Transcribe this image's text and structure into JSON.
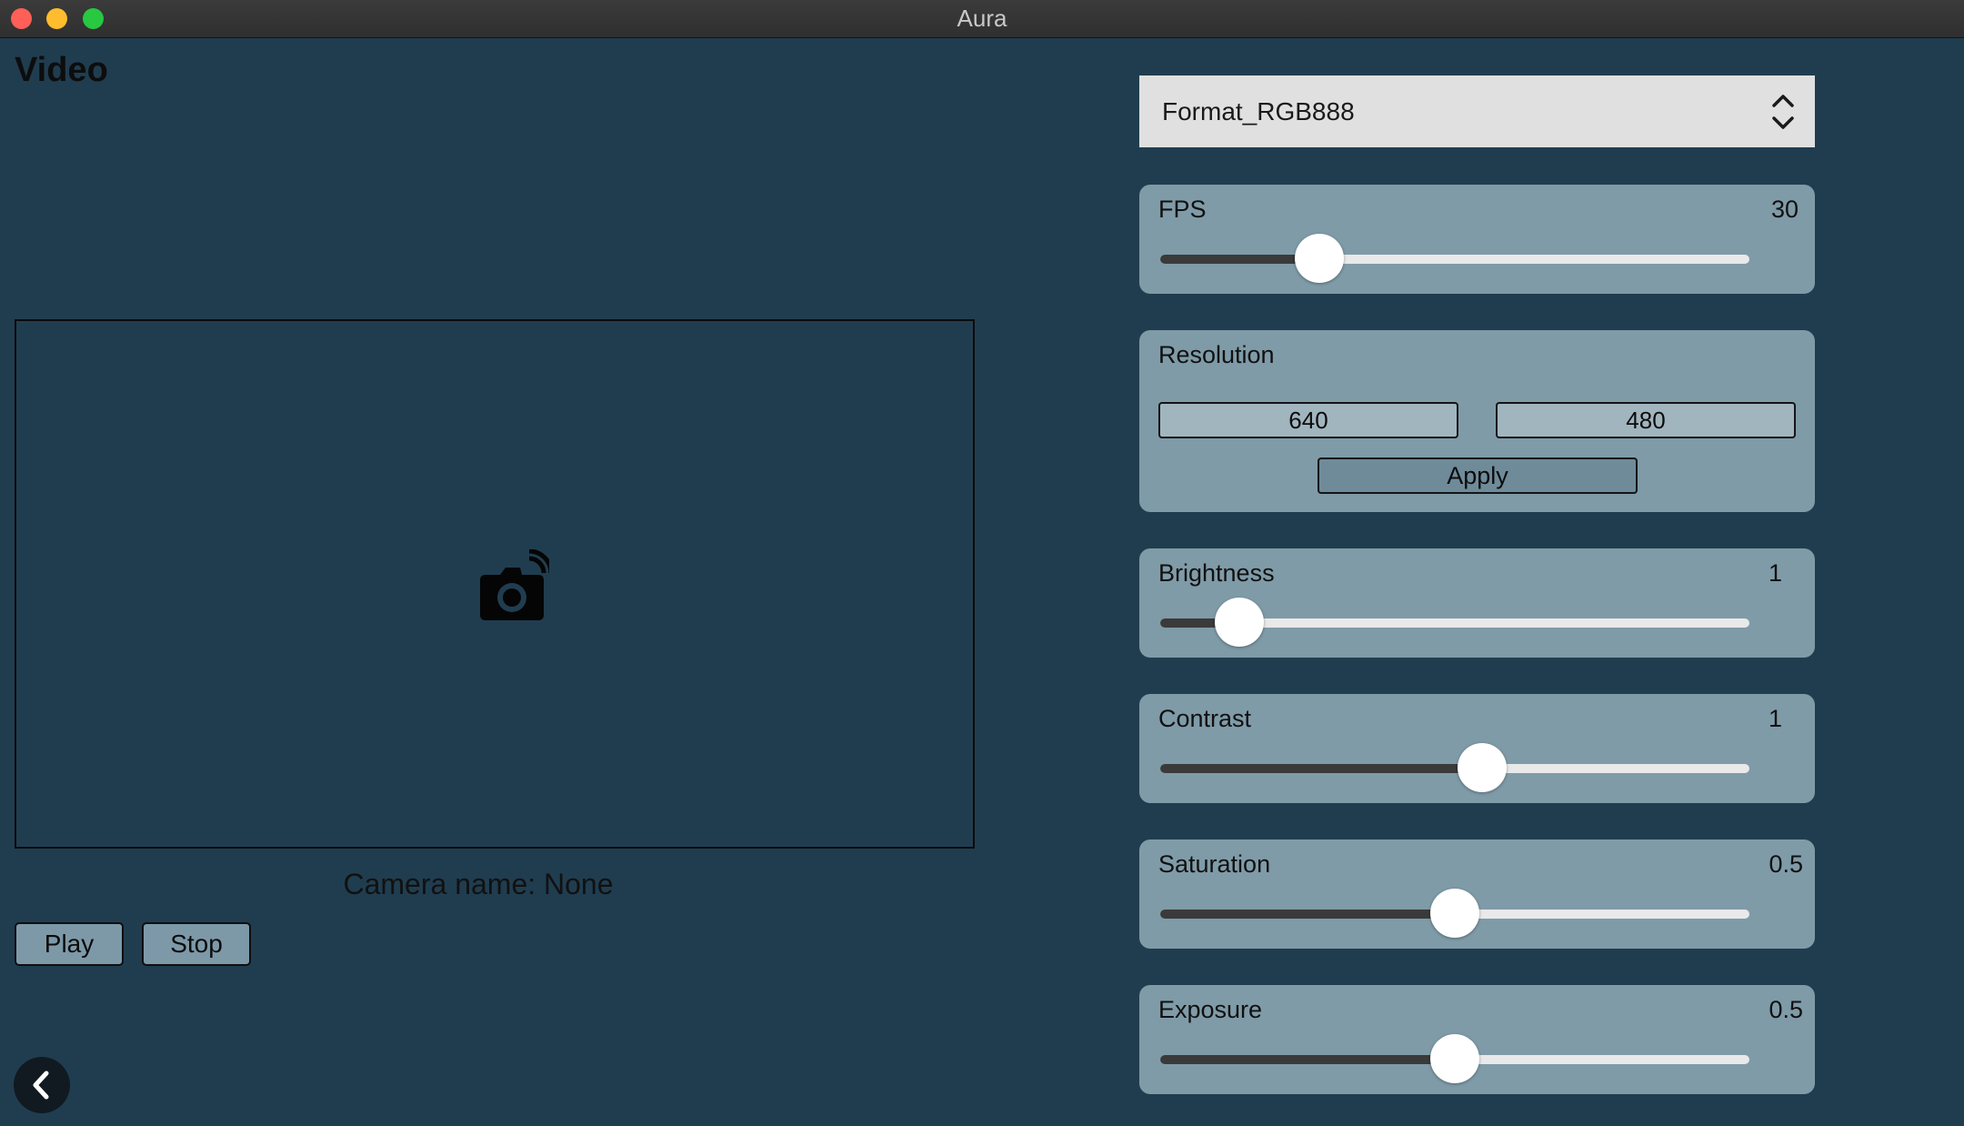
{
  "window": {
    "title": "Aura"
  },
  "page": {
    "title": "Video"
  },
  "camera": {
    "name_text": "Camera name: None"
  },
  "controls": {
    "play_label": "Play",
    "stop_label": "Stop"
  },
  "format": {
    "selected": "Format_RGB888"
  },
  "fps": {
    "label": "FPS",
    "value": "30",
    "level": 0.27
  },
  "resolution": {
    "label": "Resolution",
    "width": "640",
    "height": "480",
    "apply_label": "Apply"
  },
  "brightness": {
    "label": "Brightness",
    "value": "1",
    "level": 0.135
  },
  "contrast": {
    "label": "Contrast",
    "value": "1",
    "level": 0.546
  },
  "saturation": {
    "label": "Saturation",
    "value": "0.5",
    "level": 0.5
  },
  "exposure": {
    "label": "Exposure",
    "value": "0.5",
    "level": 0.5
  },
  "colors": {
    "background": "#203d50",
    "panel": "#7f9ba8",
    "slider_fill": "#3a3a3a",
    "slider_track": "#e9e9e9",
    "select_bg": "#e0e0e0"
  },
  "icons": {
    "camera": "camera-wifi-icon",
    "back": "chevron-left-icon",
    "select": "up-down-chevron-icon"
  }
}
